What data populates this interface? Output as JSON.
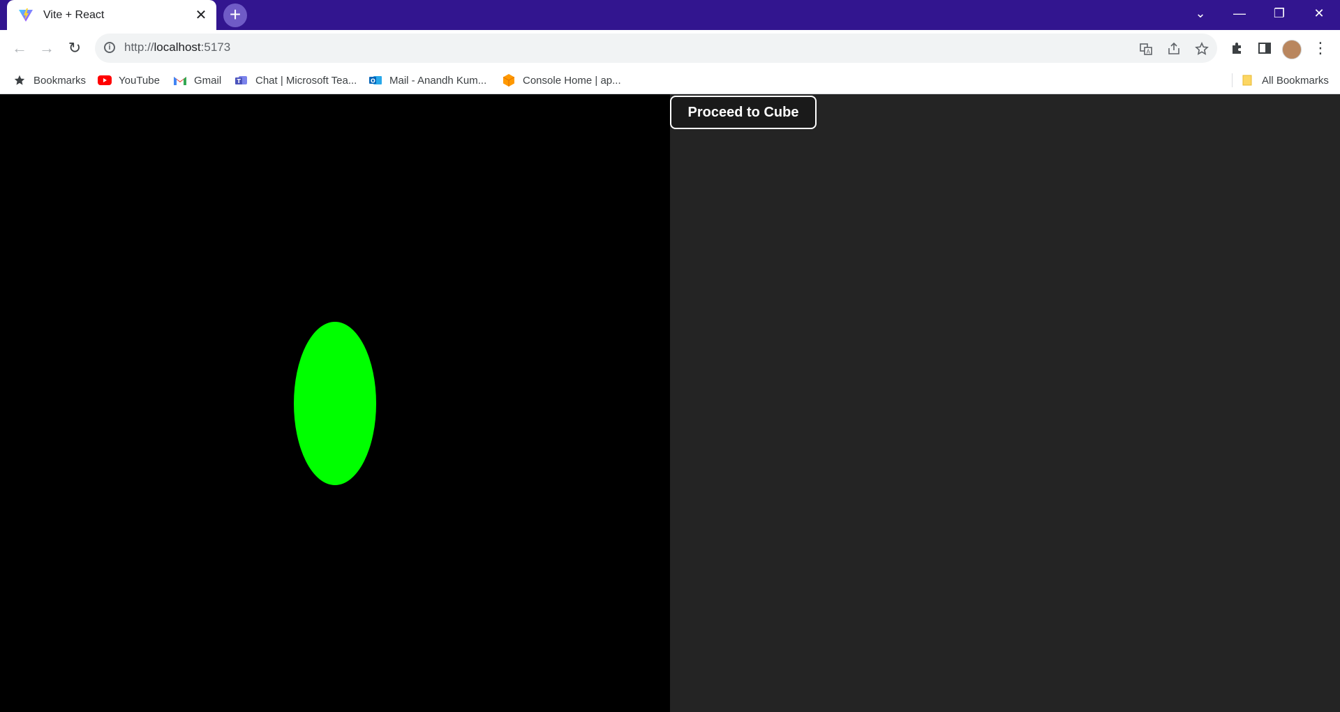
{
  "browser": {
    "tab": {
      "title": "Vite + React",
      "favicon": "vite-logo-icon",
      "close_glyph": "✕"
    },
    "new_tab_glyph": "+",
    "window_controls": {
      "tabs_menu": "⌄",
      "minimize": "—",
      "restore": "❐",
      "close": "✕"
    },
    "nav": {
      "back": "←",
      "forward": "→",
      "reload": "↻"
    },
    "address": {
      "scheme": "http://",
      "host": "localhost",
      "port": ":5173"
    },
    "bookmarks": [
      {
        "label": "Bookmarks",
        "icon": "star-icon"
      },
      {
        "label": "YouTube",
        "icon": "youtube-icon"
      },
      {
        "label": "Gmail",
        "icon": "gmail-icon"
      },
      {
        "label": "Chat | Microsoft Tea...",
        "icon": "teams-icon"
      },
      {
        "label": "Mail - Anandh Kum...",
        "icon": "outlook-icon"
      },
      {
        "label": "Console Home | ap...",
        "icon": "aws-icon"
      }
    ],
    "all_bookmarks": "All Bookmarks"
  },
  "page": {
    "proceed_button": "Proceed to Cube",
    "colors": {
      "canvas_bg": "#000000",
      "shape": "#00ff00",
      "page_bg": "#242424"
    }
  }
}
